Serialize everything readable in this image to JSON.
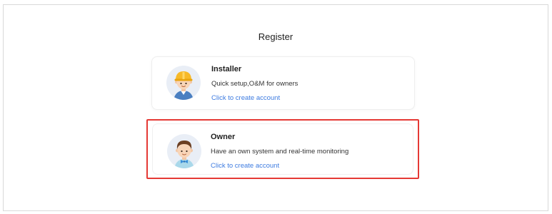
{
  "page": {
    "title": "Register"
  },
  "cards": [
    {
      "role": "Installer",
      "description": "Quick setup,O&M for owners",
      "link": "Click to create account",
      "icon": "installer-avatar-icon"
    },
    {
      "role": "Owner",
      "description": "Have an own system and real-time monitoring",
      "link": "Click to create account",
      "icon": "owner-avatar-icon",
      "highlighted": true
    }
  ],
  "colors": {
    "link": "#3d7be0",
    "highlight_border": "#e53935",
    "avatar_background": "#e9eef6"
  }
}
